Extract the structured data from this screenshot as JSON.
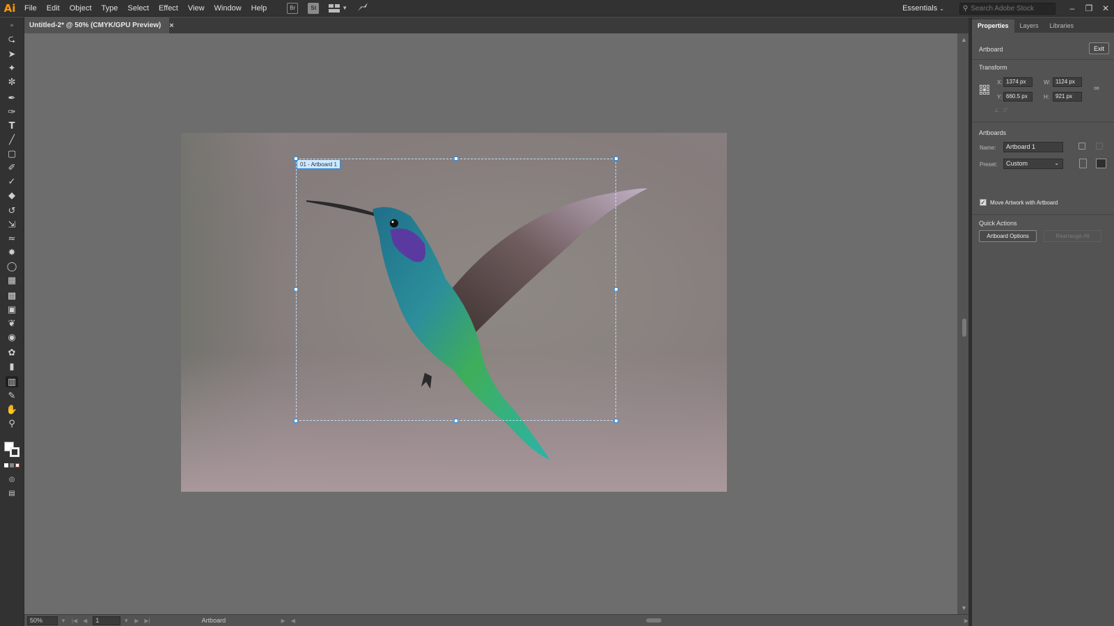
{
  "app": {
    "logo": "Ai"
  },
  "menubar": {
    "items": [
      "File",
      "Edit",
      "Object",
      "Type",
      "Select",
      "Effect",
      "View",
      "Window",
      "Help"
    ],
    "icons": [
      "bridge-icon",
      "stock-icon",
      "arrange-documents-icon",
      "gpu-performance-icon"
    ],
    "icon_labels": {
      "bridge": "Br",
      "stock": "St"
    },
    "workspace": "Essentials",
    "search_placeholder": "Search Adobe Stock"
  },
  "document": {
    "tab_title": "Untitled-2* @ 50% (CMYK/GPU Preview)",
    "close": "×",
    "artboard_label": "01 - Artboard 1"
  },
  "statusbar": {
    "zoom": "50%",
    "page": "1",
    "tool_status": "Artboard"
  },
  "panel": {
    "tabs": [
      "Properties",
      "Layers",
      "Libraries"
    ],
    "section_artboard": "Artboard",
    "exit_label": "Exit",
    "transform_title": "Transform",
    "x_label": "X:",
    "x_value": "1374 px",
    "y_label": "Y:",
    "y_value": "660.5 px",
    "w_label": "W:",
    "w_value": "1124 px",
    "h_label": "H:",
    "h_value": "921 px",
    "angle_value": "0°",
    "artboards_title": "Artboards",
    "name_label": "Name:",
    "name_value": "Artboard 1",
    "preset_label": "Preset:",
    "preset_value": "Custom",
    "move_artwork_label": "Move Artwork with Artboard",
    "move_artwork_checked": true,
    "quick_actions_title": "Quick Actions",
    "artboard_options_label": "Artboard Options",
    "rearrange_all_label": "Rearrange All"
  },
  "colors": {
    "accent": "#2a8ee6",
    "brand": "#ff9a00"
  }
}
